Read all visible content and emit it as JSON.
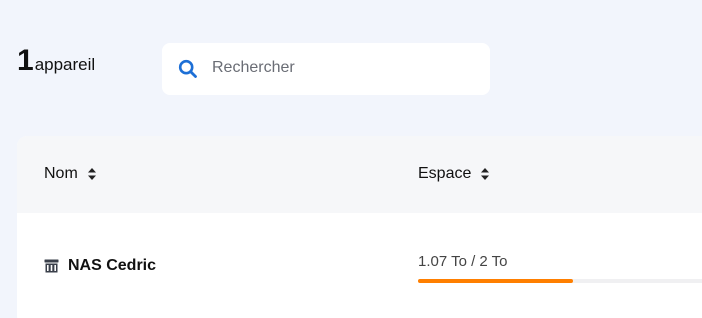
{
  "header": {
    "count": "1",
    "count_label": "appareil"
  },
  "search": {
    "placeholder": "Rechercher",
    "icon": "search-icon"
  },
  "table": {
    "columns": [
      {
        "label": "Nom",
        "icon": "sort-icon"
      },
      {
        "label": "Espace",
        "icon": "sort-icon"
      }
    ],
    "rows": [
      {
        "icon": "nas-icon",
        "name": "NAS Cedric",
        "space": "1.07 To / 2 To",
        "usage_fraction": 0.535
      }
    ]
  },
  "colors": {
    "accent": "#ff7f00",
    "search_icon": "#1d6fd6",
    "background": "#f2f5fc"
  }
}
